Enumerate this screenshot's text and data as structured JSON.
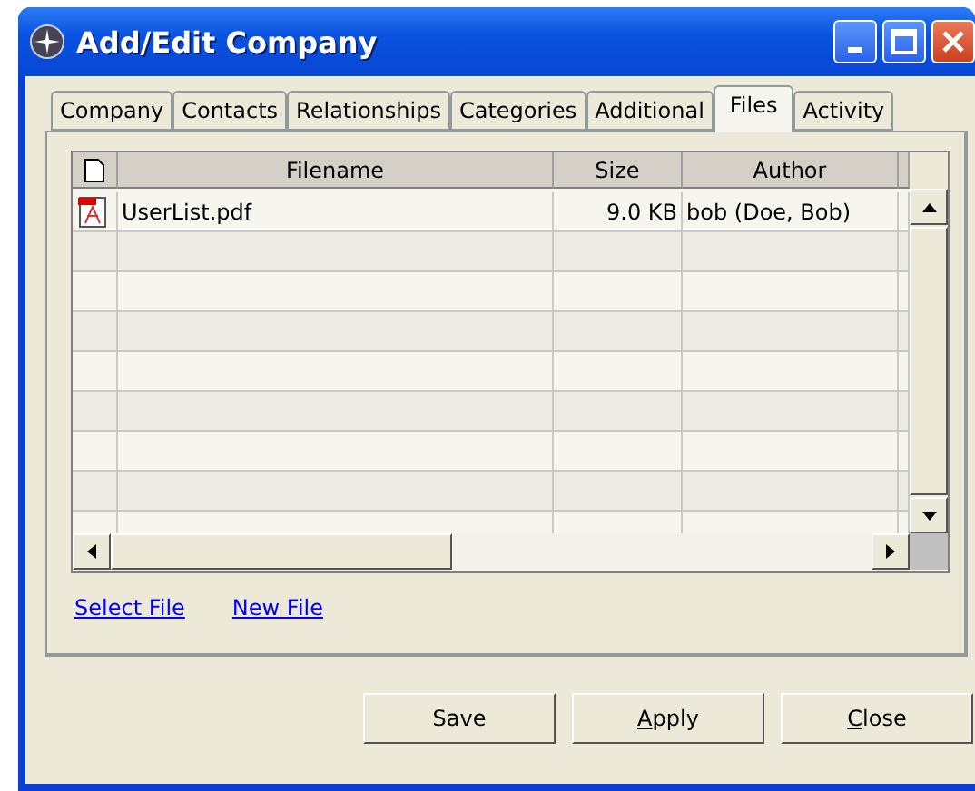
{
  "window": {
    "title": "Add/Edit Company"
  },
  "tabs": [
    {
      "label": "Company",
      "selected": false
    },
    {
      "label": "Contacts",
      "selected": false
    },
    {
      "label": "Relationships",
      "selected": false
    },
    {
      "label": "Categories",
      "selected": false
    },
    {
      "label": "Additional",
      "selected": false
    },
    {
      "label": "Files",
      "selected": true
    },
    {
      "label": "Activity",
      "selected": false
    }
  ],
  "table": {
    "columns": [
      "Filename",
      "Size",
      "Author"
    ],
    "rows": [
      {
        "filename": "UserList.pdf",
        "size": "9.0 KB",
        "author": "bob (Doe, Bob)"
      }
    ]
  },
  "links": [
    "Select File",
    "New File"
  ],
  "buttons": [
    {
      "label": "Save",
      "mnemonic": false
    },
    {
      "label": "Apply",
      "mnemonic": true
    },
    {
      "label": "Close",
      "mnemonic": true
    }
  ]
}
